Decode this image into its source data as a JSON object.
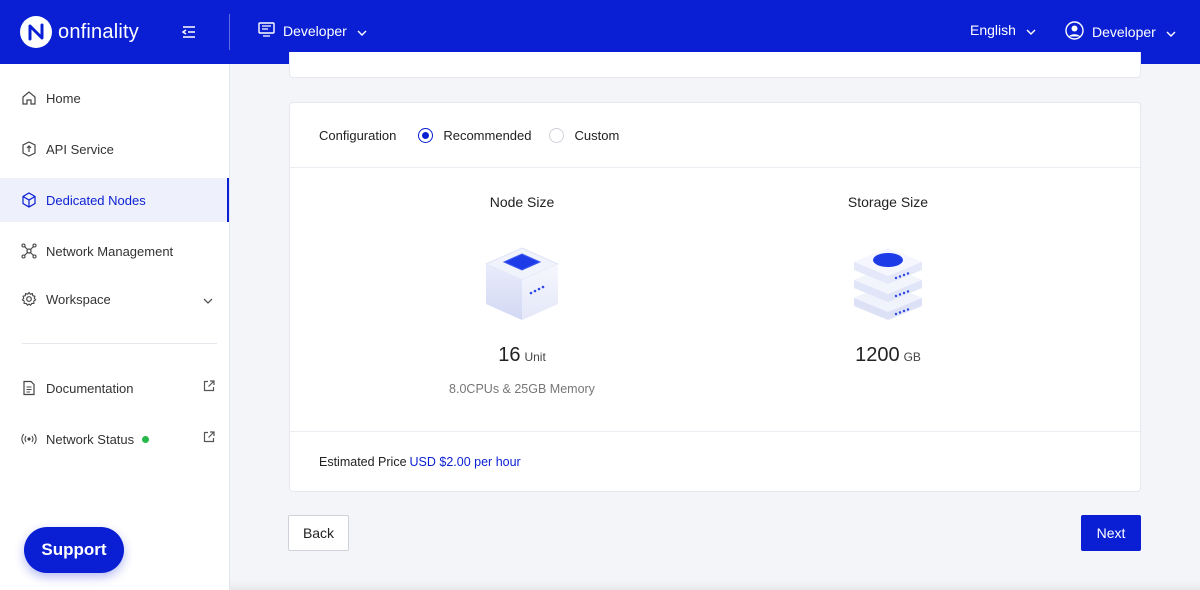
{
  "topbar": {
    "brand": "onfinality",
    "workspace_label": "Developer",
    "language": "English",
    "user_label": "Developer"
  },
  "sidebar": {
    "items": [
      {
        "label": "Home",
        "icon": "home-icon"
      },
      {
        "label": "API Service",
        "icon": "api-icon"
      },
      {
        "label": "Dedicated Nodes",
        "icon": "cube-icon",
        "active": true
      },
      {
        "label": "Network Management",
        "icon": "network-icon"
      },
      {
        "label": "Workspace",
        "icon": "gear-icon"
      },
      {
        "label": "Documentation",
        "icon": "document-icon"
      },
      {
        "label": "Network Status",
        "icon": "broadcast-icon"
      }
    ],
    "support_label": "Support"
  },
  "config": {
    "label": "Configuration",
    "options": [
      "Recommended",
      "Custom"
    ],
    "selected": "Recommended"
  },
  "node_size": {
    "title": "Node Size",
    "value": "16",
    "unit": "Unit",
    "detail": "8.0CPUs & 25GB Memory"
  },
  "storage_size": {
    "title": "Storage Size",
    "value": "1200",
    "unit": "GB"
  },
  "price": {
    "label": "Estimated Price",
    "value": "USD $2.00 per hour"
  },
  "actions": {
    "back": "Back",
    "next": "Next"
  },
  "colors": {
    "brand": "#0a1fd3",
    "status_online": "#27b84a"
  }
}
